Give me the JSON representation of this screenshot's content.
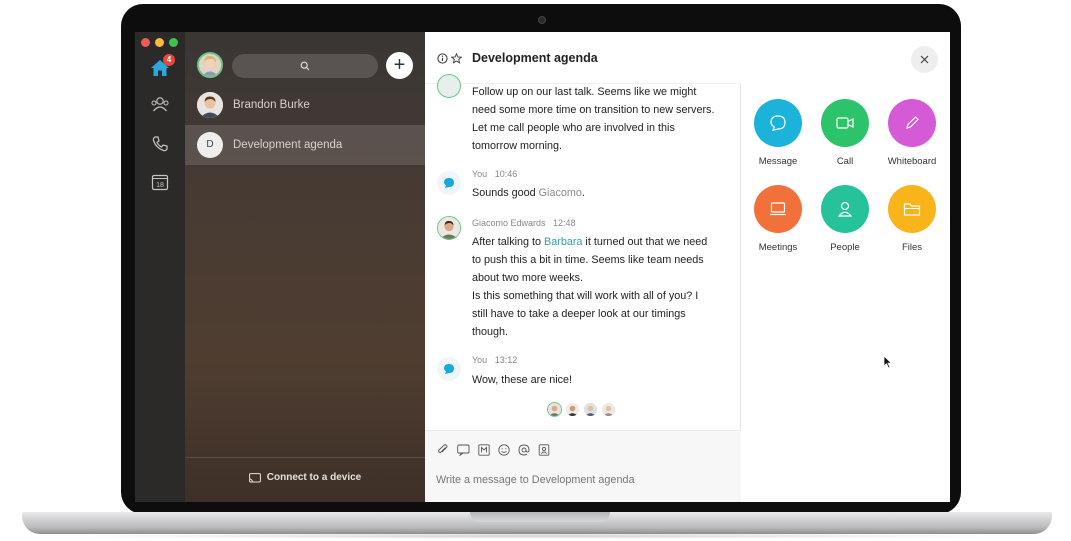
{
  "nav": {
    "home_badge": "4",
    "calendar_day": "18"
  },
  "conversation_list": {
    "items": [
      {
        "name": "Brandon Burke",
        "avatar": "photo"
      },
      {
        "name": "Development agenda",
        "avatar_letter": "D",
        "selected": true
      }
    ],
    "connect_label": "Connect to a device"
  },
  "chat": {
    "title": "Development agenda",
    "messages": [
      {
        "lines": [
          "Follow up on our last talk. Seems like we might",
          "need some more time on transition to new servers.",
          "Let me call people who are involved in this",
          "tomorrow morning."
        ]
      },
      {
        "sender": "You",
        "time": "10:46",
        "text_before": "Sounds good ",
        "text_faded": "Giacomo",
        "text_after": "."
      },
      {
        "sender": "Giacomo Edwards",
        "time": "12:48",
        "line1_before": "After talking to ",
        "line1_mention": "Barbara",
        "line1_after": " it turned out that we need",
        "lines": [
          "to push this a bit in time. Seems like team needs",
          "about two more weeks.",
          "Is this something that will work with all of you? I",
          "still have to take a deeper look at our timings",
          "though."
        ]
      },
      {
        "sender": "You",
        "time": "13:12",
        "text": "Wow, these are nice!"
      }
    ],
    "composer_placeholder": "Write a message to Development agenda"
  },
  "actions": {
    "items": [
      {
        "label": "Message",
        "color": "#1bb3d9",
        "icon": "chat-bubble-icon"
      },
      {
        "label": "Call",
        "color": "#2cc36b",
        "icon": "video-camera-icon"
      },
      {
        "label": "Whiteboard",
        "color": "#d45ad6",
        "icon": "pencil-icon"
      },
      {
        "label": "Meetings",
        "color": "#f2713a",
        "icon": "laptop-icon"
      },
      {
        "label": "People",
        "color": "#26c29a",
        "icon": "person-icon"
      },
      {
        "label": "Files",
        "color": "#f8b41a",
        "icon": "folder-icon"
      }
    ]
  },
  "colors": {
    "accent_green": "#6cc58c",
    "mention": "#34a0a4",
    "badge": "#e8483b"
  }
}
